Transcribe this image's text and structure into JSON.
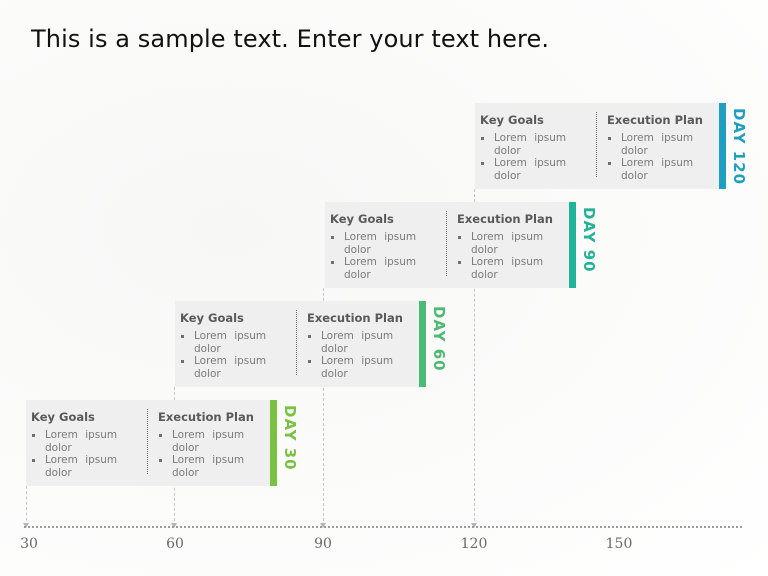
{
  "title": "This is a sample text. Enter your text here.",
  "axis": {
    "ticks": [
      "30",
      "60",
      "90",
      "120",
      "150"
    ]
  },
  "cards": [
    {
      "day_label": "DAY 30",
      "color": "#7ac143",
      "key_goals": {
        "heading": "Key Goals",
        "items": [
          "Lorem ipsum dolor",
          "Lorem ipsum dolor"
        ]
      },
      "execution_plan": {
        "heading": "Execution Plan",
        "items": [
          "Lorem ipsum dolor",
          "Lorem ipsum dolor"
        ]
      }
    },
    {
      "day_label": "DAY 60",
      "color": "#4dba73",
      "key_goals": {
        "heading": "Key Goals",
        "items": [
          "Lorem ipsum dolor",
          "Lorem ipsum dolor"
        ]
      },
      "execution_plan": {
        "heading": "Execution Plan",
        "items": [
          "Lorem ipsum dolor",
          "Lorem ipsum dolor"
        ]
      }
    },
    {
      "day_label": "DAY 90",
      "color": "#22b296",
      "key_goals": {
        "heading": "Key Goals",
        "items": [
          "Lorem ipsum dolor",
          "Lorem ipsum dolor"
        ]
      },
      "execution_plan": {
        "heading": "Execution Plan",
        "items": [
          "Lorem ipsum dolor",
          "Lorem ipsum dolor"
        ]
      }
    },
    {
      "day_label": "DAY 120",
      "color": "#1f9fbf",
      "key_goals": {
        "heading": "Key Goals",
        "items": [
          "Lorem ipsum dolor",
          "Lorem ipsum dolor"
        ]
      },
      "execution_plan": {
        "heading": "Execution Plan",
        "items": [
          "Lorem ipsum dolor",
          "Lorem ipsum dolor"
        ]
      }
    }
  ]
}
